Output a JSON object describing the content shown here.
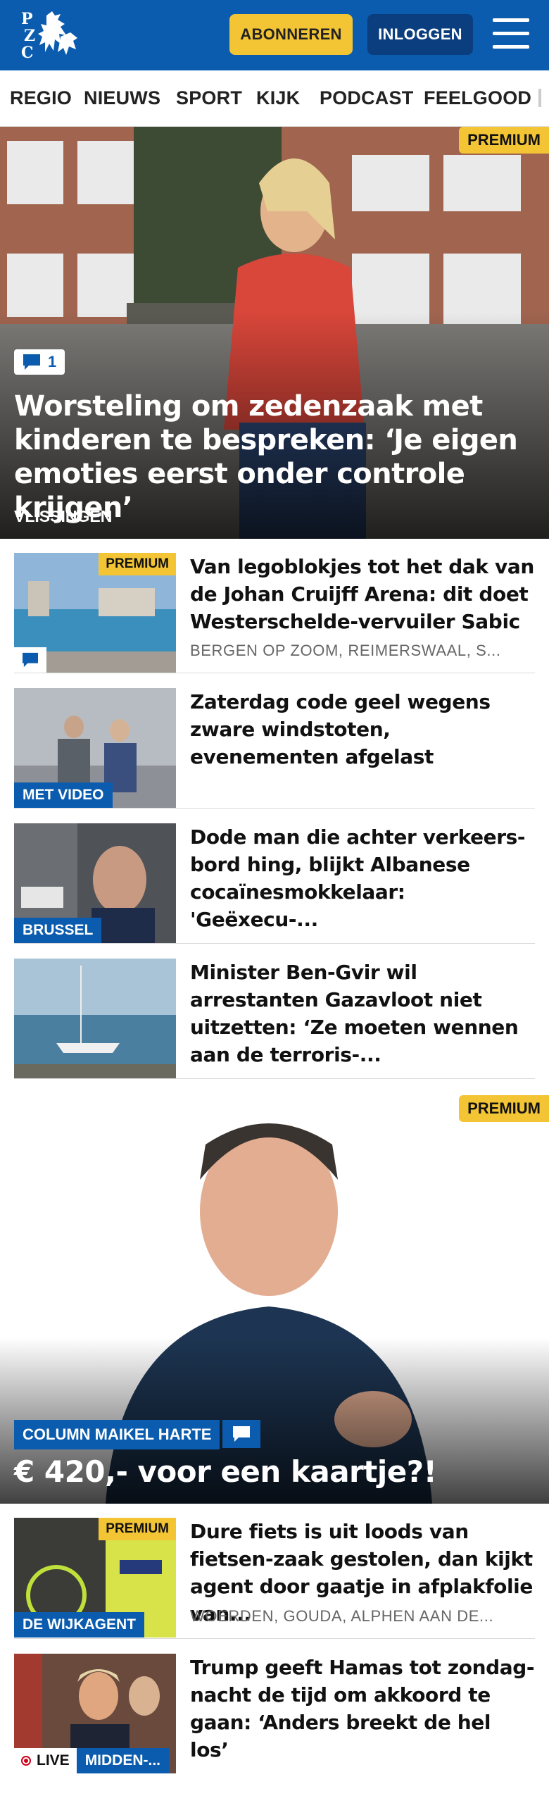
{
  "header": {
    "logo_text": "PZC",
    "subscribe_label": "ABONNEREN",
    "login_label": "INLOGGEN"
  },
  "nav": {
    "items": [
      "REGIO",
      "NIEUWS",
      "SPORT",
      "KIJK",
      "PODCAST",
      "FEELGOOD"
    ]
  },
  "hero": {
    "premium": "PREMIUM",
    "comment_count": "1",
    "title": "Worsteling om zedenzaak met kinderen te bespreken: ‘Je eigen emoties eerst onder controle krijgen’",
    "location": "VLISSINGEN"
  },
  "articles": [
    {
      "premium": "PREMIUM",
      "title": "Van legoblokjes tot het dak van de Johan Cruijff Arena: dit doet Westerschelde-vervuiler Sabic",
      "meta": "BERGEN OP ZOOM, REIMERSWAAL, S..."
    },
    {
      "label": "MET VIDEO",
      "title": "Zaterdag code geel wegens zware windstoten, evenementen afgelast"
    },
    {
      "label": "BRUSSEL",
      "title": "Dode man die achter verkeers-bord hing, blijkt Albanese cocaïnesmokkelaar: 'Geëxecu-..."
    },
    {
      "title": "Minister Ben-Gvir wil arrestanten Gazavloot niet uitzetten: ‘Ze moeten wennen aan de terroris-..."
    }
  ],
  "column": {
    "premium": "PREMIUM",
    "label": "COLUMN MAIKEL HARTE",
    "title": "€ 420,- voor een kaartje?!"
  },
  "articles2": [
    {
      "premium": "PREMIUM",
      "label": "DE WIJKAGENT",
      "title": "Dure fiets is uit loods van fietsen-zaak gestolen, dan kijkt agent door gaatje in afplakfolie van...",
      "meta": "WOERDEN, GOUDA, ALPHEN AAN DE..."
    },
    {
      "live": "LIVE",
      "label": "MIDDEN-...",
      "title": "Trump geeft Hamas tot zondag-nacht de tijd om akkoord te gaan: ‘Anders breekt de hel los’"
    }
  ],
  "colors": {
    "brand_blue": "#0b5cae",
    "dark_blue": "#0a3e7e",
    "premium_yellow": "#f3c534",
    "live_red": "#d0021b"
  }
}
